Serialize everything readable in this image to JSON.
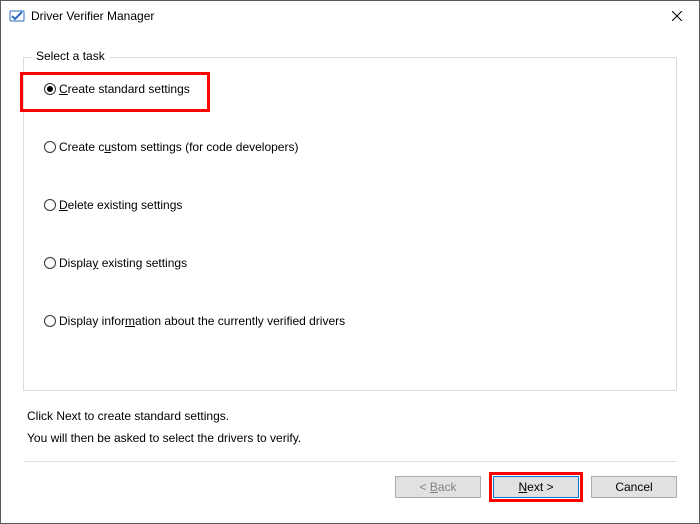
{
  "titlebar": {
    "title": "Driver Verifier Manager"
  },
  "group": {
    "legend": "Select a task"
  },
  "options": [
    {
      "pre": "",
      "mn": "C",
      "post": "reate standard settings",
      "checked": true
    },
    {
      "pre": "Create c",
      "mn": "u",
      "post": "stom settings (for code developers)",
      "checked": false
    },
    {
      "pre": "",
      "mn": "D",
      "post": "elete existing settings",
      "checked": false
    },
    {
      "pre": "Displa",
      "mn": "y",
      "post": " existing settings",
      "checked": false
    },
    {
      "pre": "Display infor",
      "mn": "m",
      "post": "ation about the currently verified drivers",
      "checked": false
    }
  ],
  "desc": {
    "line1": "Click Next to create standard settings.",
    "line2": "You will then be asked to select the drivers to verify."
  },
  "buttons": {
    "back_pre": "< ",
    "back_mn": "B",
    "back_post": "ack",
    "next_pre": "",
    "next_mn": "N",
    "next_post": "ext >",
    "cancel": "Cancel"
  }
}
